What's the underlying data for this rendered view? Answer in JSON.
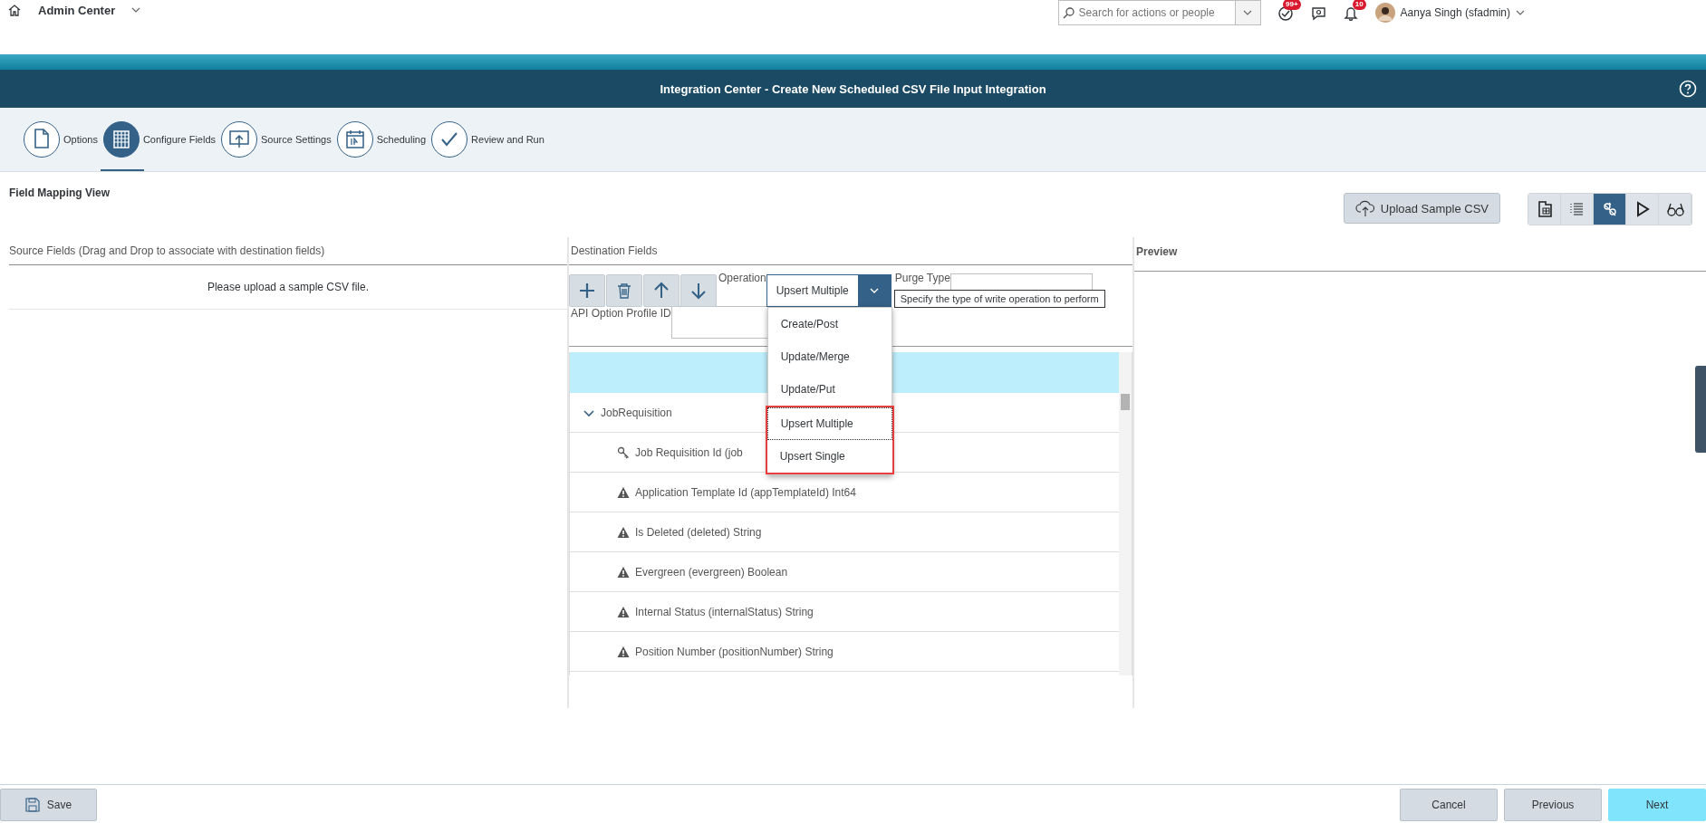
{
  "top_bar": {
    "title": "Admin Center",
    "search": {
      "placeholder": "Search for actions or people"
    },
    "notifications": [
      {
        "kind": "todo",
        "badge": "99+"
      },
      {
        "kind": "chat"
      },
      {
        "kind": "bell",
        "badge": "10"
      }
    ],
    "user": "Aanya Singh (sfadmin)"
  },
  "header": {
    "title": "Integration Center - Create New Scheduled CSV File Input Integration"
  },
  "steps": [
    {
      "label": "Options",
      "kind": "document",
      "selected": false
    },
    {
      "label": "Configure Fields",
      "kind": "grid",
      "selected": true
    },
    {
      "label": "Source Settings",
      "kind": "upload",
      "selected": false
    },
    {
      "label": "Scheduling",
      "kind": "calendar",
      "selected": false
    },
    {
      "label": "Review and Run",
      "kind": "check",
      "selected": false
    }
  ],
  "view_title": "Field Mapping View",
  "upload_button": "Upload Sample CSV",
  "view_modes": [
    {
      "kind": "table",
      "selected": false
    },
    {
      "kind": "list",
      "selected": false
    },
    {
      "kind": "mapping",
      "selected": true
    },
    {
      "kind": "play",
      "selected": false
    },
    {
      "kind": "glasses",
      "selected": false
    }
  ],
  "source": {
    "heading": "Source Fields (Drag and Drop to associate with destination fields)",
    "message": "Please upload a sample CSV file."
  },
  "destination": {
    "heading": "Destination Fields",
    "tools": [
      {
        "kind": "add"
      },
      {
        "kind": "delete"
      },
      {
        "kind": "up"
      },
      {
        "kind": "down"
      }
    ],
    "operation": {
      "label": "Operation",
      "value": "Upsert Multiple",
      "expanded": true,
      "tooltip": "Specify the type of write operation to perform",
      "options": [
        {
          "label": "Create/Post",
          "selected": false,
          "highlighted": false
        },
        {
          "label": "Update/Merge",
          "selected": false,
          "highlighted": false
        },
        {
          "label": "Update/Put",
          "selected": false,
          "highlighted": false
        },
        {
          "label": "Upsert Multiple",
          "selected": true,
          "highlighted": true
        },
        {
          "label": "Upsert Single",
          "selected": false,
          "highlighted": true
        }
      ]
    },
    "purge_type": {
      "label": "Purge Type"
    },
    "api_option_profile": {
      "label": "API Option Profile ID"
    },
    "tree": [
      {
        "label": "JobRequisition",
        "expanded": true,
        "children": [
          {
            "label": "Job Requisition Id (job",
            "kind": "key"
          },
          {
            "label": "Application Template Id (appTemplateId) Int64",
            "kind": "warning"
          },
          {
            "label": "Is Deleted (deleted) String",
            "kind": "warning"
          },
          {
            "label": "Evergreen (evergreen) Boolean",
            "kind": "warning"
          },
          {
            "label": "Internal Status (internalStatus) String",
            "kind": "warning"
          },
          {
            "label": "Position Number (positionNumber) String",
            "kind": "warning"
          }
        ]
      }
    ]
  },
  "preview": {
    "heading": "Preview"
  },
  "footer": {
    "save": "Save",
    "buttons": [
      {
        "label": "Cancel",
        "kind": "secondary"
      },
      {
        "label": "Previous",
        "kind": "secondary"
      },
      {
        "label": "Next",
        "kind": "primary"
      }
    ]
  }
}
